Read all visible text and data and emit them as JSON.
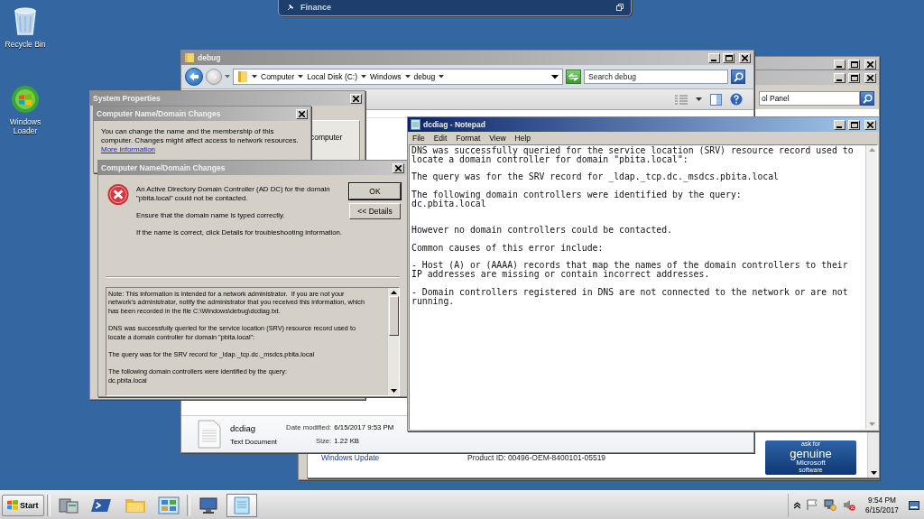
{
  "desktop_icons": [
    {
      "kind": "recycle-bin",
      "label": "Recycle Bin"
    },
    {
      "kind": "loader",
      "label": "Windows Loader"
    }
  ],
  "finance_window": {
    "title": "Finance"
  },
  "control_panel": {
    "search_value": "ol Panel",
    "link": "Windows Update",
    "product_id": "Product ID:  00496-OEM-8400101-05519",
    "badge": [
      "ask for",
      "genuine",
      "Microsoft",
      "software"
    ]
  },
  "explorer": {
    "title": "debug",
    "breadcrumb": [
      "Computer",
      "Local Disk (C:)",
      "Windows",
      "debug"
    ],
    "search": {
      "placeholder": "Search debug"
    },
    "details": {
      "name": "dcdiag",
      "type": "Text Document",
      "date_label": "Date modified:",
      "date": "6/15/2017 9:53 PM",
      "size_label": "Size:",
      "size": "1.22 KB"
    }
  },
  "system_properties": {
    "title": "System Properties",
    "tab_text": "computer"
  },
  "name_changes": {
    "title": "Computer Name/Domain Changes",
    "text": "You can change the name and the membership of this\ncomputer. Changes might affect access to network resources.",
    "link": "More information"
  },
  "error_dialog": {
    "title": "Computer Name/Domain Changes",
    "messages": [
      "An Active Directory Domain Controller (AD DC) for the domain\n\"pbita.local\" could not be contacted.",
      "Ensure that the domain name is typed correctly.",
      "If the name is correct, click Details for troubleshooting information."
    ],
    "buttons": [
      "OK",
      "<< Details"
    ],
    "details_text": "Note: This information is intended for a network administrator.  If you are not your\nnetwork's administrator, notify the administrator that you received this information, which\nhas been recorded in the file C:\\Windows\\debug\\dcdiag.txt.\n\nDNS was successfully queried for the service location (SRV) resource record used to\nlocate a domain controller for domain \"pbita.local\":\n\nThe query was for the SRV record for _ldap._tcp.dc._msdcs.pbita.local\n\nThe following domain controllers were identified by the query:\ndc.pbita.local"
  },
  "notepad": {
    "title": "dcdiag - Notepad",
    "menu": [
      "File",
      "Edit",
      "Format",
      "View",
      "Help"
    ],
    "text": "DNS was successfully queried for the service location (SRV) resource record used to\nlocate a domain controller for domain \"pbita.local\":\n\nThe query was for the SRV record for _ldap._tcp.dc._msdcs.pbita.local\n\nThe following domain controllers were identified by the query:\ndc.pbita.local\n\n\nHowever no domain controllers could be contacted.\n\nCommon causes of this error include:\n\n- Host (A) or (AAAA) records that map the names of the domain controllers to their\nIP addresses are missing or contain incorrect addresses.\n\n- Domain controllers registered in DNS are not connected to the network or are not\nrunning."
  },
  "taskbar": {
    "start": "Start",
    "items": [
      {
        "kind": "server",
        "selected": false
      },
      {
        "kind": "powershell",
        "selected": false
      },
      {
        "kind": "folder",
        "selected": false
      },
      {
        "kind": "control-panel",
        "selected": false
      },
      {
        "kind": "system",
        "selected": false
      },
      {
        "kind": "notepad",
        "selected": true
      }
    ],
    "clock": {
      "time": "9:54 PM",
      "date": "6/15/2017"
    }
  }
}
